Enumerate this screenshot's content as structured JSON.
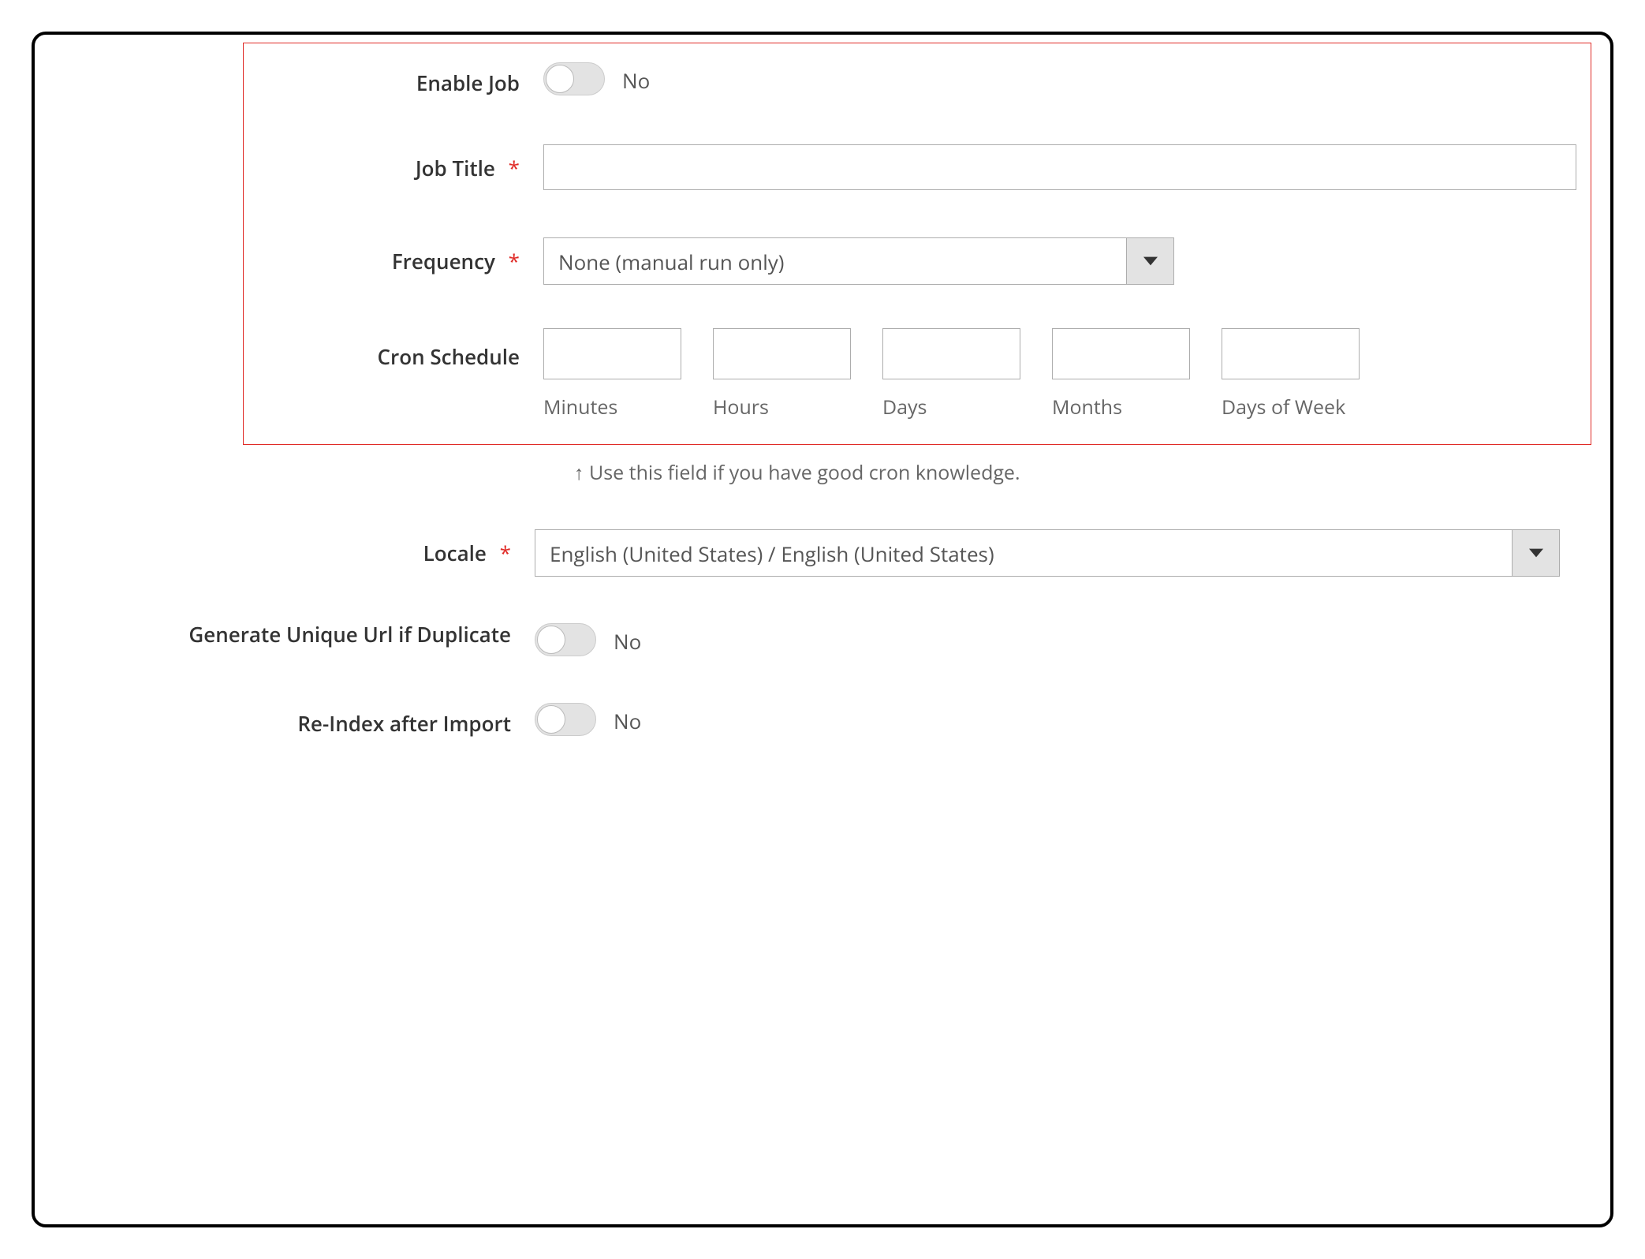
{
  "fields": {
    "enable_job": {
      "label": "Enable Job",
      "value": "No"
    },
    "job_title": {
      "label": "Job Title",
      "value": ""
    },
    "frequency": {
      "label": "Frequency",
      "value": "None (manual run only)"
    },
    "cron_schedule": {
      "label": "Cron Schedule",
      "cols": {
        "minutes": {
          "label": "Minutes",
          "value": ""
        },
        "hours": {
          "label": "Hours",
          "value": ""
        },
        "days": {
          "label": "Days",
          "value": ""
        },
        "months": {
          "label": "Months",
          "value": ""
        },
        "dow": {
          "label": "Days of Week",
          "value": ""
        }
      },
      "hint": "↑ Use this field if you have good cron knowledge."
    },
    "locale": {
      "label": "Locale",
      "value": "English (United States) / English (United States)"
    },
    "unique_url": {
      "label": "Generate Unique Url if Duplicate",
      "value": "No"
    },
    "reindex": {
      "label": "Re-Index after Import",
      "value": "No"
    }
  },
  "required_mark": "*"
}
